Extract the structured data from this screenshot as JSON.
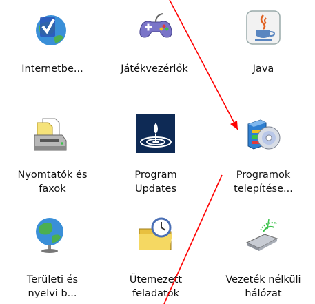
{
  "items": [
    {
      "label_lines": [
        "Internetbe..."
      ],
      "icon": "internet-options-icon"
    },
    {
      "label_lines": [
        "Játékvezérlők"
      ],
      "icon": "game-controllers-icon"
    },
    {
      "label_lines": [
        "Java"
      ],
      "icon": "java-icon"
    },
    {
      "label_lines": [
        "Nyomtatók és",
        "faxok"
      ],
      "icon": "printers-faxes-icon"
    },
    {
      "label_lines": [
        "Program",
        "Updates"
      ],
      "icon": "program-updates-icon"
    },
    {
      "label_lines": [
        "Programok",
        "telepítése..."
      ],
      "icon": "add-remove-programs-icon"
    },
    {
      "label_lines": [
        "Területi és",
        "nyelvi b..."
      ],
      "icon": "regional-language-icon"
    },
    {
      "label_lines": [
        "Ütemezett",
        "feladatok"
      ],
      "icon": "scheduled-tasks-icon"
    },
    {
      "label_lines": [
        "Vezeték nélküli",
        "hálózat"
      ],
      "icon": "wireless-network-icon"
    }
  ],
  "annotation_color": "#ff0000"
}
